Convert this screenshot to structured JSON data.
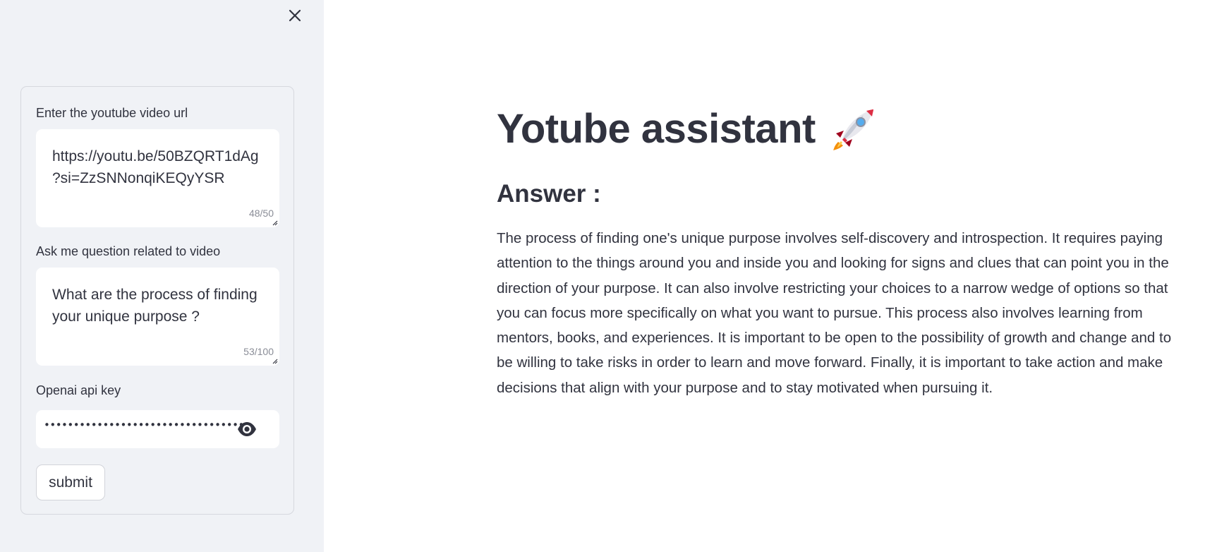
{
  "sidebar": {
    "close_icon": "close-icon",
    "url_field": {
      "label": "Enter the youtube video url",
      "value": "https://youtu.be/50BZQRT1dAg?si=ZzSNNonqiKEQyYSR",
      "counter": "48/50"
    },
    "question_field": {
      "label": "Ask me question related to video",
      "value": "What are the process of finding your unique purpose ?",
      "counter": "53/100"
    },
    "api_key_field": {
      "label": "Openai api key",
      "masked_value": "•••••••••••••••••••••••••••••••••••",
      "toggle_icon": "eye-icon"
    },
    "submit_label": "submit"
  },
  "main": {
    "title": "Yotube assistant",
    "title_icon": "rocket-icon",
    "subheader": "Answer :",
    "answer": "The process of finding one's unique purpose involves self-discovery and introspection. It requires paying attention to the things around you and inside you and looking for signs and clues that can point you in the direction of your purpose. It can also involve restricting your choices to a narrow wedge of options so that you can focus more specifically on what you want to pursue. This process also involves learning from mentors, books, and experiences. It is important to be open to the possibility of growth and change and to be willing to take risks in order to learn and move forward. Finally, it is important to take action and make decisions that align with your purpose and to stay motivated when pursuing it."
  },
  "colors": {
    "sidebar_bg": "#f0f2f6",
    "text": "#31333f",
    "main_bg": "#ffffff"
  }
}
